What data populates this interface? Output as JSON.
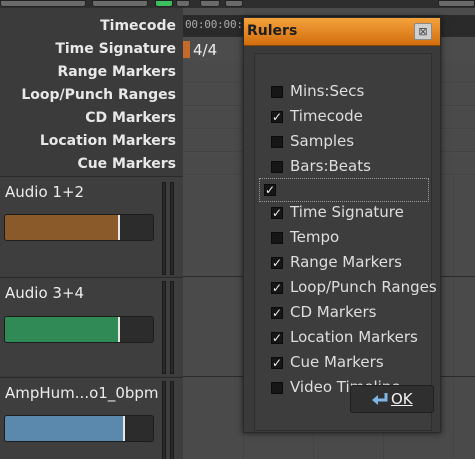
{
  "ruler_labels": [
    {
      "label": "Timecode"
    },
    {
      "label": "Time Signature"
    },
    {
      "label": "Range Markers"
    },
    {
      "label": "Loop/Punch Ranges"
    },
    {
      "label": "CD Markers"
    },
    {
      "label": "Location Markers"
    },
    {
      "label": "Cue Markers"
    }
  ],
  "timeline": {
    "timecode_value": "00:00:00:",
    "time_signature_value": "4/4"
  },
  "tracks": [
    {
      "name": "Audio 1+2",
      "fader_color": "#8a5a2b",
      "fader_level": 0.78
    },
    {
      "name": "Audio 3+4",
      "fader_color": "#2f8a55",
      "fader_level": 0.78
    },
    {
      "name": "AmpHum...o1_0bpm",
      "fader_color": "#5b89ad",
      "fader_level": 0.81
    }
  ],
  "dialog": {
    "title": "Rulers",
    "close_glyph": "⊠",
    "options": [
      {
        "label": "Mins:Secs",
        "checked": false
      },
      {
        "label": "Timecode",
        "checked": true
      },
      {
        "label": "Samples",
        "checked": false
      },
      {
        "label": "Bars:Beats",
        "checked": false
      },
      {
        "label": "",
        "checked": true,
        "focused": true
      },
      {
        "label": "Time Signature",
        "checked": true
      },
      {
        "label": "Tempo",
        "checked": false
      },
      {
        "label": "Range Markers",
        "checked": true
      },
      {
        "label": "Loop/Punch Ranges",
        "checked": true
      },
      {
        "label": "CD Markers",
        "checked": true
      },
      {
        "label": "Location Markers",
        "checked": true
      },
      {
        "label": "Cue Markers",
        "checked": true
      },
      {
        "label": "Video Timeline",
        "checked": false
      }
    ],
    "ok_label": "OK"
  },
  "colors": {
    "dialog_title_gradient_top": "#f3a23c",
    "dialog_title_gradient_bottom": "#d36d0e",
    "timesig_marker": "#c46a2a"
  }
}
